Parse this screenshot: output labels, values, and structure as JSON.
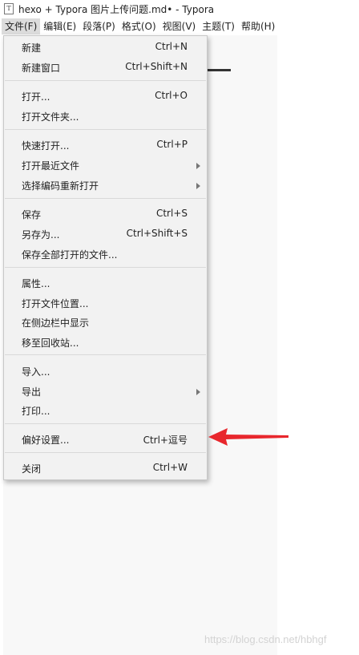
{
  "window": {
    "icon_letter": "T",
    "title": "hexo + Typora 图片上传问题.md• - Typora"
  },
  "menubar": {
    "items": [
      {
        "label": "文件(F)"
      },
      {
        "label": "编辑(E)"
      },
      {
        "label": "段落(P)"
      },
      {
        "label": "格式(O)"
      },
      {
        "label": "视图(V)"
      },
      {
        "label": "主题(T)"
      },
      {
        "label": "帮助(H)"
      }
    ]
  },
  "file_menu": {
    "new": {
      "label": "新建",
      "shortcut": "Ctrl+N"
    },
    "new_window": {
      "label": "新建窗口",
      "shortcut": "Ctrl+Shift+N"
    },
    "open": {
      "label": "打开...",
      "shortcut": "Ctrl+O"
    },
    "open_folder": {
      "label": "打开文件夹..."
    },
    "quick_open": {
      "label": "快速打开...",
      "shortcut": "Ctrl+P"
    },
    "open_recent": {
      "label": "打开最近文件"
    },
    "reopen_encoding": {
      "label": "选择编码重新打开"
    },
    "save": {
      "label": "保存",
      "shortcut": "Ctrl+S"
    },
    "save_as": {
      "label": "另存为...",
      "shortcut": "Ctrl+Shift+S"
    },
    "save_all": {
      "label": "保存全部打开的文件..."
    },
    "properties": {
      "label": "属性..."
    },
    "open_location": {
      "label": "打开文件位置..."
    },
    "reveal_sidebar": {
      "label": "在侧边栏中显示"
    },
    "move_to_trash": {
      "label": "移至回收站..."
    },
    "import": {
      "label": "导入..."
    },
    "export": {
      "label": "导出"
    },
    "print": {
      "label": "打印..."
    },
    "preferences": {
      "label": "偏好设置...",
      "shortcut": "Ctrl+逗号"
    },
    "close": {
      "label": "关闭",
      "shortcut": "Ctrl+W"
    }
  },
  "annotation": {
    "arrow_color": "#e8272d"
  },
  "watermark": {
    "text": "https://blog.csdn.net/hbhgf"
  },
  "colors": {
    "menu_bg": "#f2f2f2",
    "active_menu_bg": "#dcdcdc",
    "editor_bg": "#f8f8f8"
  }
}
